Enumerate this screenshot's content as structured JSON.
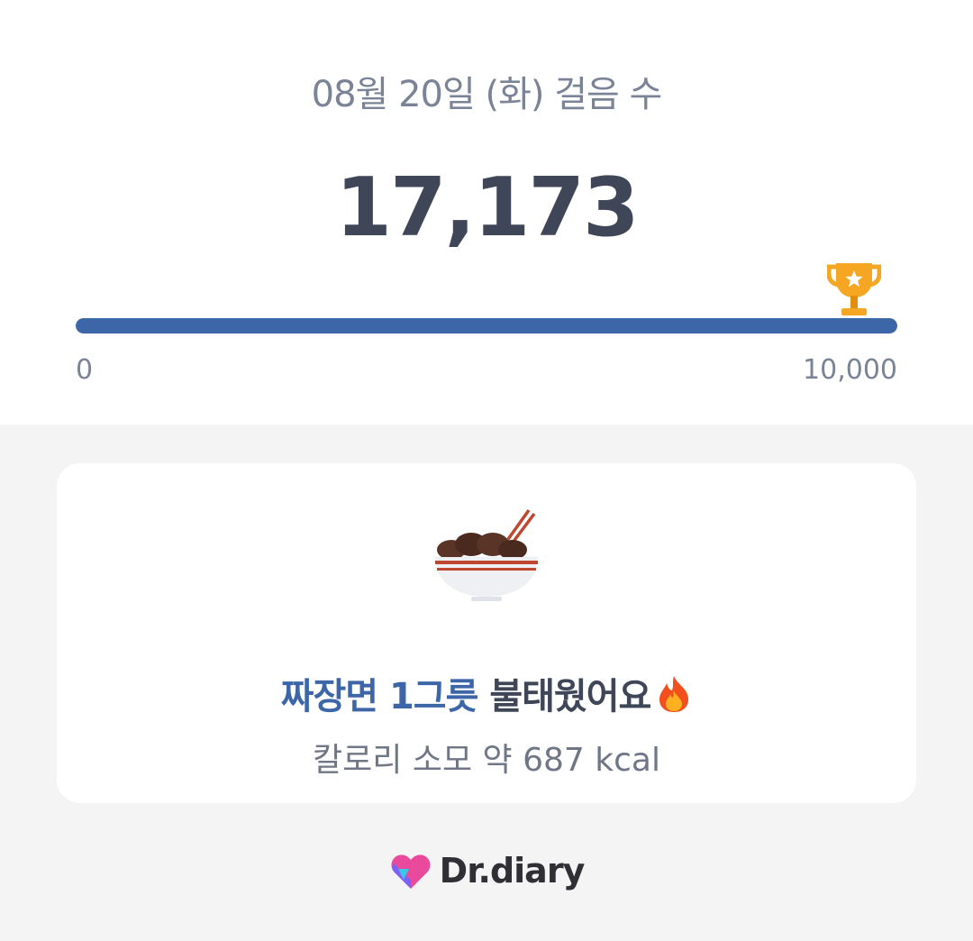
{
  "header": {
    "date_title": "08월 20일 (화) 걸음 수",
    "step_count": "17,173"
  },
  "progress": {
    "min_label": "0",
    "max_label": "10,000",
    "fill_fraction": 1.0,
    "goal_icon": "trophy-icon",
    "bar_color": "#3c66a7"
  },
  "calorie_card": {
    "food_icon": "black-bean-noodle-bowl-icon",
    "highlight": "짜장면 1그릇",
    "rest": " 불태웠어요",
    "fire_icon": "fire-icon",
    "subtitle": "칼로리 소모 약 687 kcal"
  },
  "footer": {
    "brand_name": "Dr.diary",
    "brand_icon": "heart-logo-icon"
  }
}
